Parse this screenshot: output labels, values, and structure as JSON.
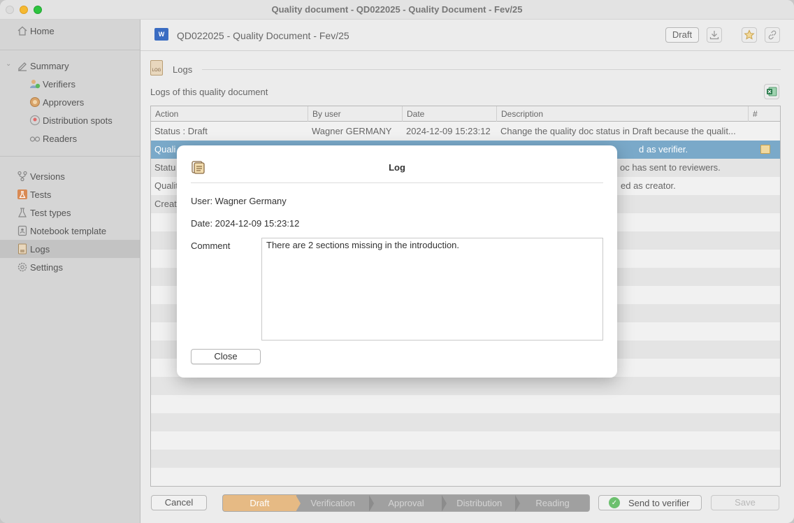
{
  "window": {
    "title": "Quality document - QD022025 - Quality Document - Fev/25"
  },
  "sidebar": {
    "home": "Home",
    "summary": "Summary",
    "sub_items": [
      {
        "label": "Verifiers",
        "icon": "verifiers-icon"
      },
      {
        "label": "Approvers",
        "icon": "approvers-icon"
      },
      {
        "label": "Distribution spots",
        "icon": "distribution-spots-icon"
      },
      {
        "label": "Readers",
        "icon": "readers-icon"
      }
    ],
    "items": [
      {
        "label": "Versions",
        "icon": "versions-icon"
      },
      {
        "label": "Tests",
        "icon": "tests-icon"
      },
      {
        "label": "Test types",
        "icon": "test-types-icon"
      },
      {
        "label": "Notebook template",
        "icon": "notebook-template-icon"
      },
      {
        "label": "Logs",
        "icon": "logs-icon",
        "active": true
      },
      {
        "label": "Settings",
        "icon": "settings-icon"
      }
    ]
  },
  "header": {
    "doc_title": "QD022025 - Quality Document - Fev/25",
    "status_button": "Draft"
  },
  "logs": {
    "section_title": "Logs",
    "subtitle": "Logs of this quality document",
    "columns": [
      "Action",
      "By user",
      "Date",
      "Description",
      "#"
    ],
    "rows": [
      {
        "action": "Status : Draft",
        "user": "Wagner GERMANY",
        "date": "2024-12-09 15:23:12",
        "description": "Change the quality doc status in Draft because the qualit..."
      },
      {
        "action": "Quali",
        "user": "",
        "date": "",
        "description": "d as verifier."
      },
      {
        "action": "Statu",
        "user": "",
        "date": "",
        "description": "oc has sent to reviewers."
      },
      {
        "action": "Qualit",
        "user": "",
        "date": "",
        "description": "ed as creator."
      },
      {
        "action": "Creat",
        "user": "",
        "date": "",
        "description": ""
      }
    ]
  },
  "footer": {
    "cancel": "Cancel",
    "workflow_steps": [
      "Draft",
      "Verification",
      "Approval",
      "Distribution",
      "Reading"
    ],
    "active_step": "Draft",
    "send": "Send to verifier",
    "save": "Save"
  },
  "dialog": {
    "title": "Log",
    "user_line": "User: Wagner Germany",
    "date_line": "Date: 2024-12-09 15:23:12",
    "comment_label": "Comment",
    "comment_text": "There are 2 sections missing in the introduction.",
    "close": "Close"
  },
  "colors": {
    "selection": "#7aa9c9",
    "workflow_active": "#e6ba84",
    "workflow_inactive": "#a0a0a0"
  }
}
